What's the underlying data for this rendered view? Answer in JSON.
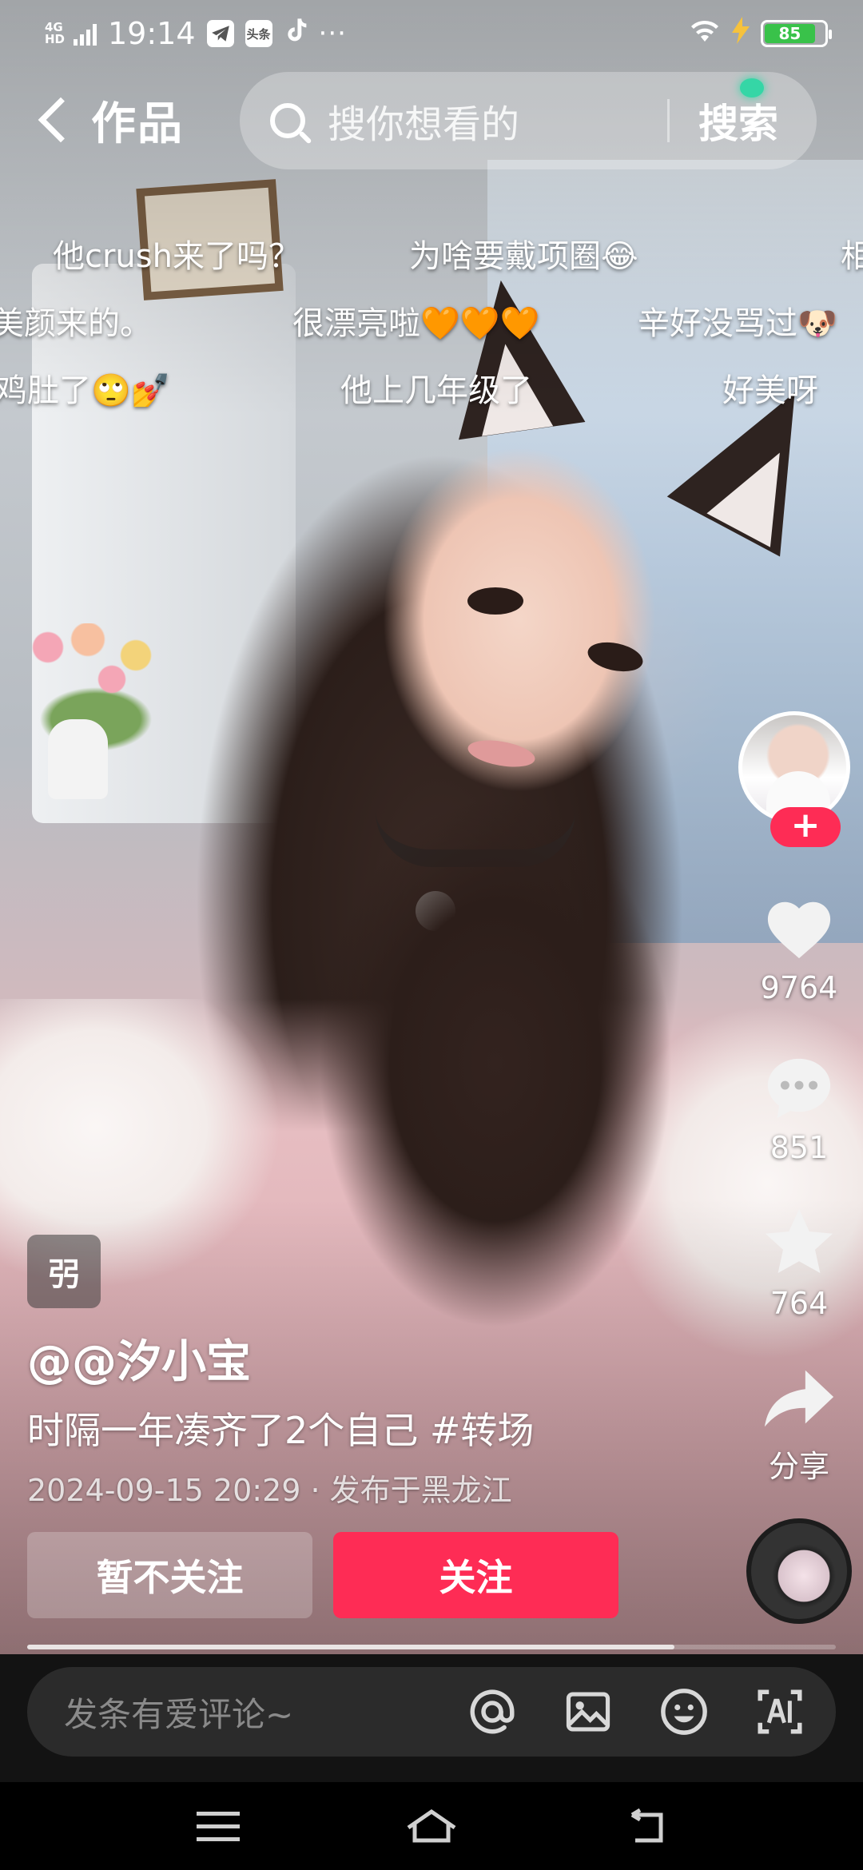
{
  "status_bar": {
    "network": "4G HD",
    "time": "19:14",
    "notif_icons": [
      "telegram-icon",
      "toutiao-icon",
      "tiktok-icon"
    ],
    "toutiao_label": "头条",
    "more": "···",
    "battery_level": "85",
    "battery_fraction": 0.85
  },
  "header": {
    "back_label": "作品",
    "search_placeholder": "搜你想看的",
    "search_button": "搜索"
  },
  "danmaku": [
    {
      "text": "他crush来了吗？"
    },
    {
      "text": "为啥要戴项圈😂"
    },
    {
      "text": "相"
    },
    {
      "text": "美颜来的。"
    },
    {
      "text": "很漂亮啦🧡🧡🧡"
    },
    {
      "text": "辛好没骂过🐶"
    },
    {
      "text": "鸡肚了🙄💅"
    },
    {
      "text": "他上几年级了"
    },
    {
      "text": "好美呀"
    }
  ],
  "rail": {
    "follow_plus": "+",
    "likes": "9764",
    "comments": "851",
    "favorites": "764",
    "share": "分享"
  },
  "info": {
    "badge": "弜",
    "author": "@@汐小宝",
    "description": "时隔一年凑齐了2个自己 #转场",
    "meta": "2024-09-15 20:29 · 发布于黑龙江",
    "btn_unfollow": "暂不关注",
    "btn_follow": "关注",
    "progress": 0.8
  },
  "comment_bar": {
    "placeholder": "发条有爱评论~",
    "icons": [
      "at-icon",
      "image-icon",
      "emoji-icon",
      "ai-icon"
    ]
  },
  "colors": {
    "accent": "#fe2c55",
    "battery": "#39c24a",
    "bolt": "#f6c23d"
  }
}
